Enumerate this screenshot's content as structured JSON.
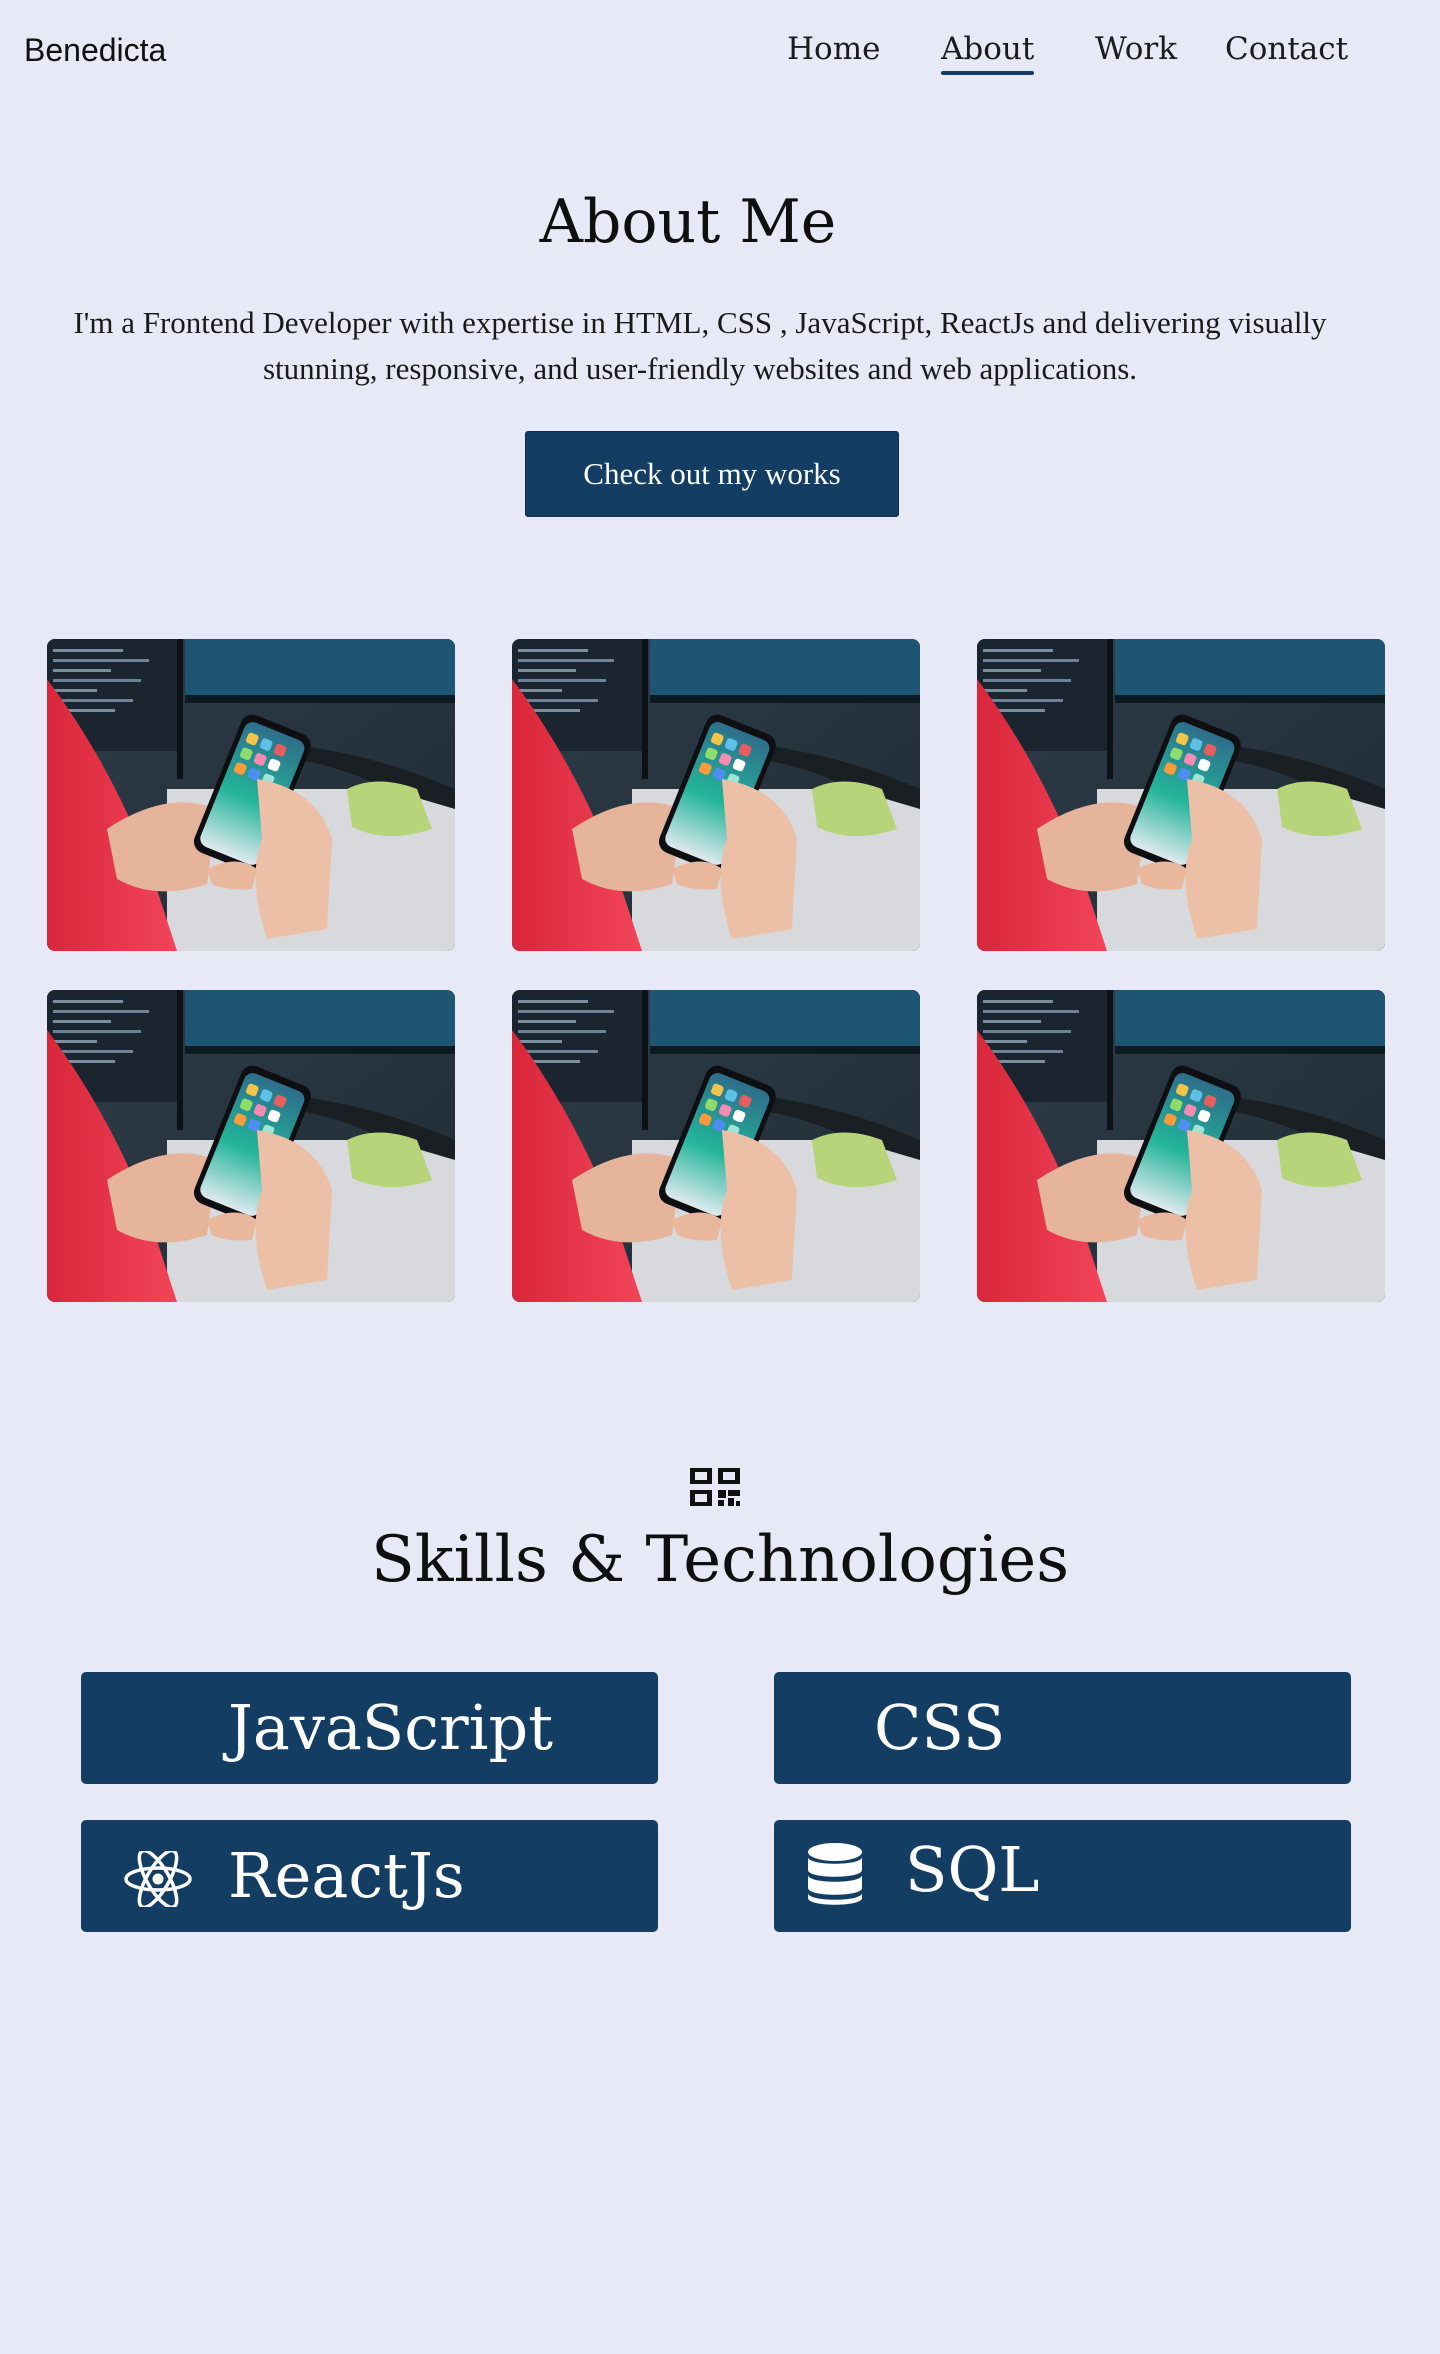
{
  "header": {
    "brand": "Benedicta",
    "nav": [
      {
        "label": "Home",
        "active": false
      },
      {
        "label": "About",
        "active": true
      },
      {
        "label": "Work",
        "active": false
      },
      {
        "label": "Contact",
        "active": false
      }
    ]
  },
  "about": {
    "title": "About Me",
    "description": "I'm a Frontend Developer with expertise in HTML, CSS , JavaScript, ReactJs and delivering visually stunning, responsive, and user-friendly websites and web applications.",
    "cta_label": "Check out my works"
  },
  "gallery": {
    "image_subject": "hands-holding-smartphone-photo",
    "count": 6
  },
  "skills": {
    "header_icon": "qr-code-icon",
    "title": "Skills & Technologies",
    "items": [
      {
        "label": "JavaScript",
        "icon": ""
      },
      {
        "label": "CSS",
        "icon": ""
      },
      {
        "label": "ReactJs",
        "icon": "react-atom-icon"
      },
      {
        "label": "SQL",
        "icon": "database-icon"
      }
    ]
  },
  "colors": {
    "background": "#e8e9f6",
    "primary": "#143d63",
    "text": "#111111",
    "card_text": "#ffffff"
  }
}
